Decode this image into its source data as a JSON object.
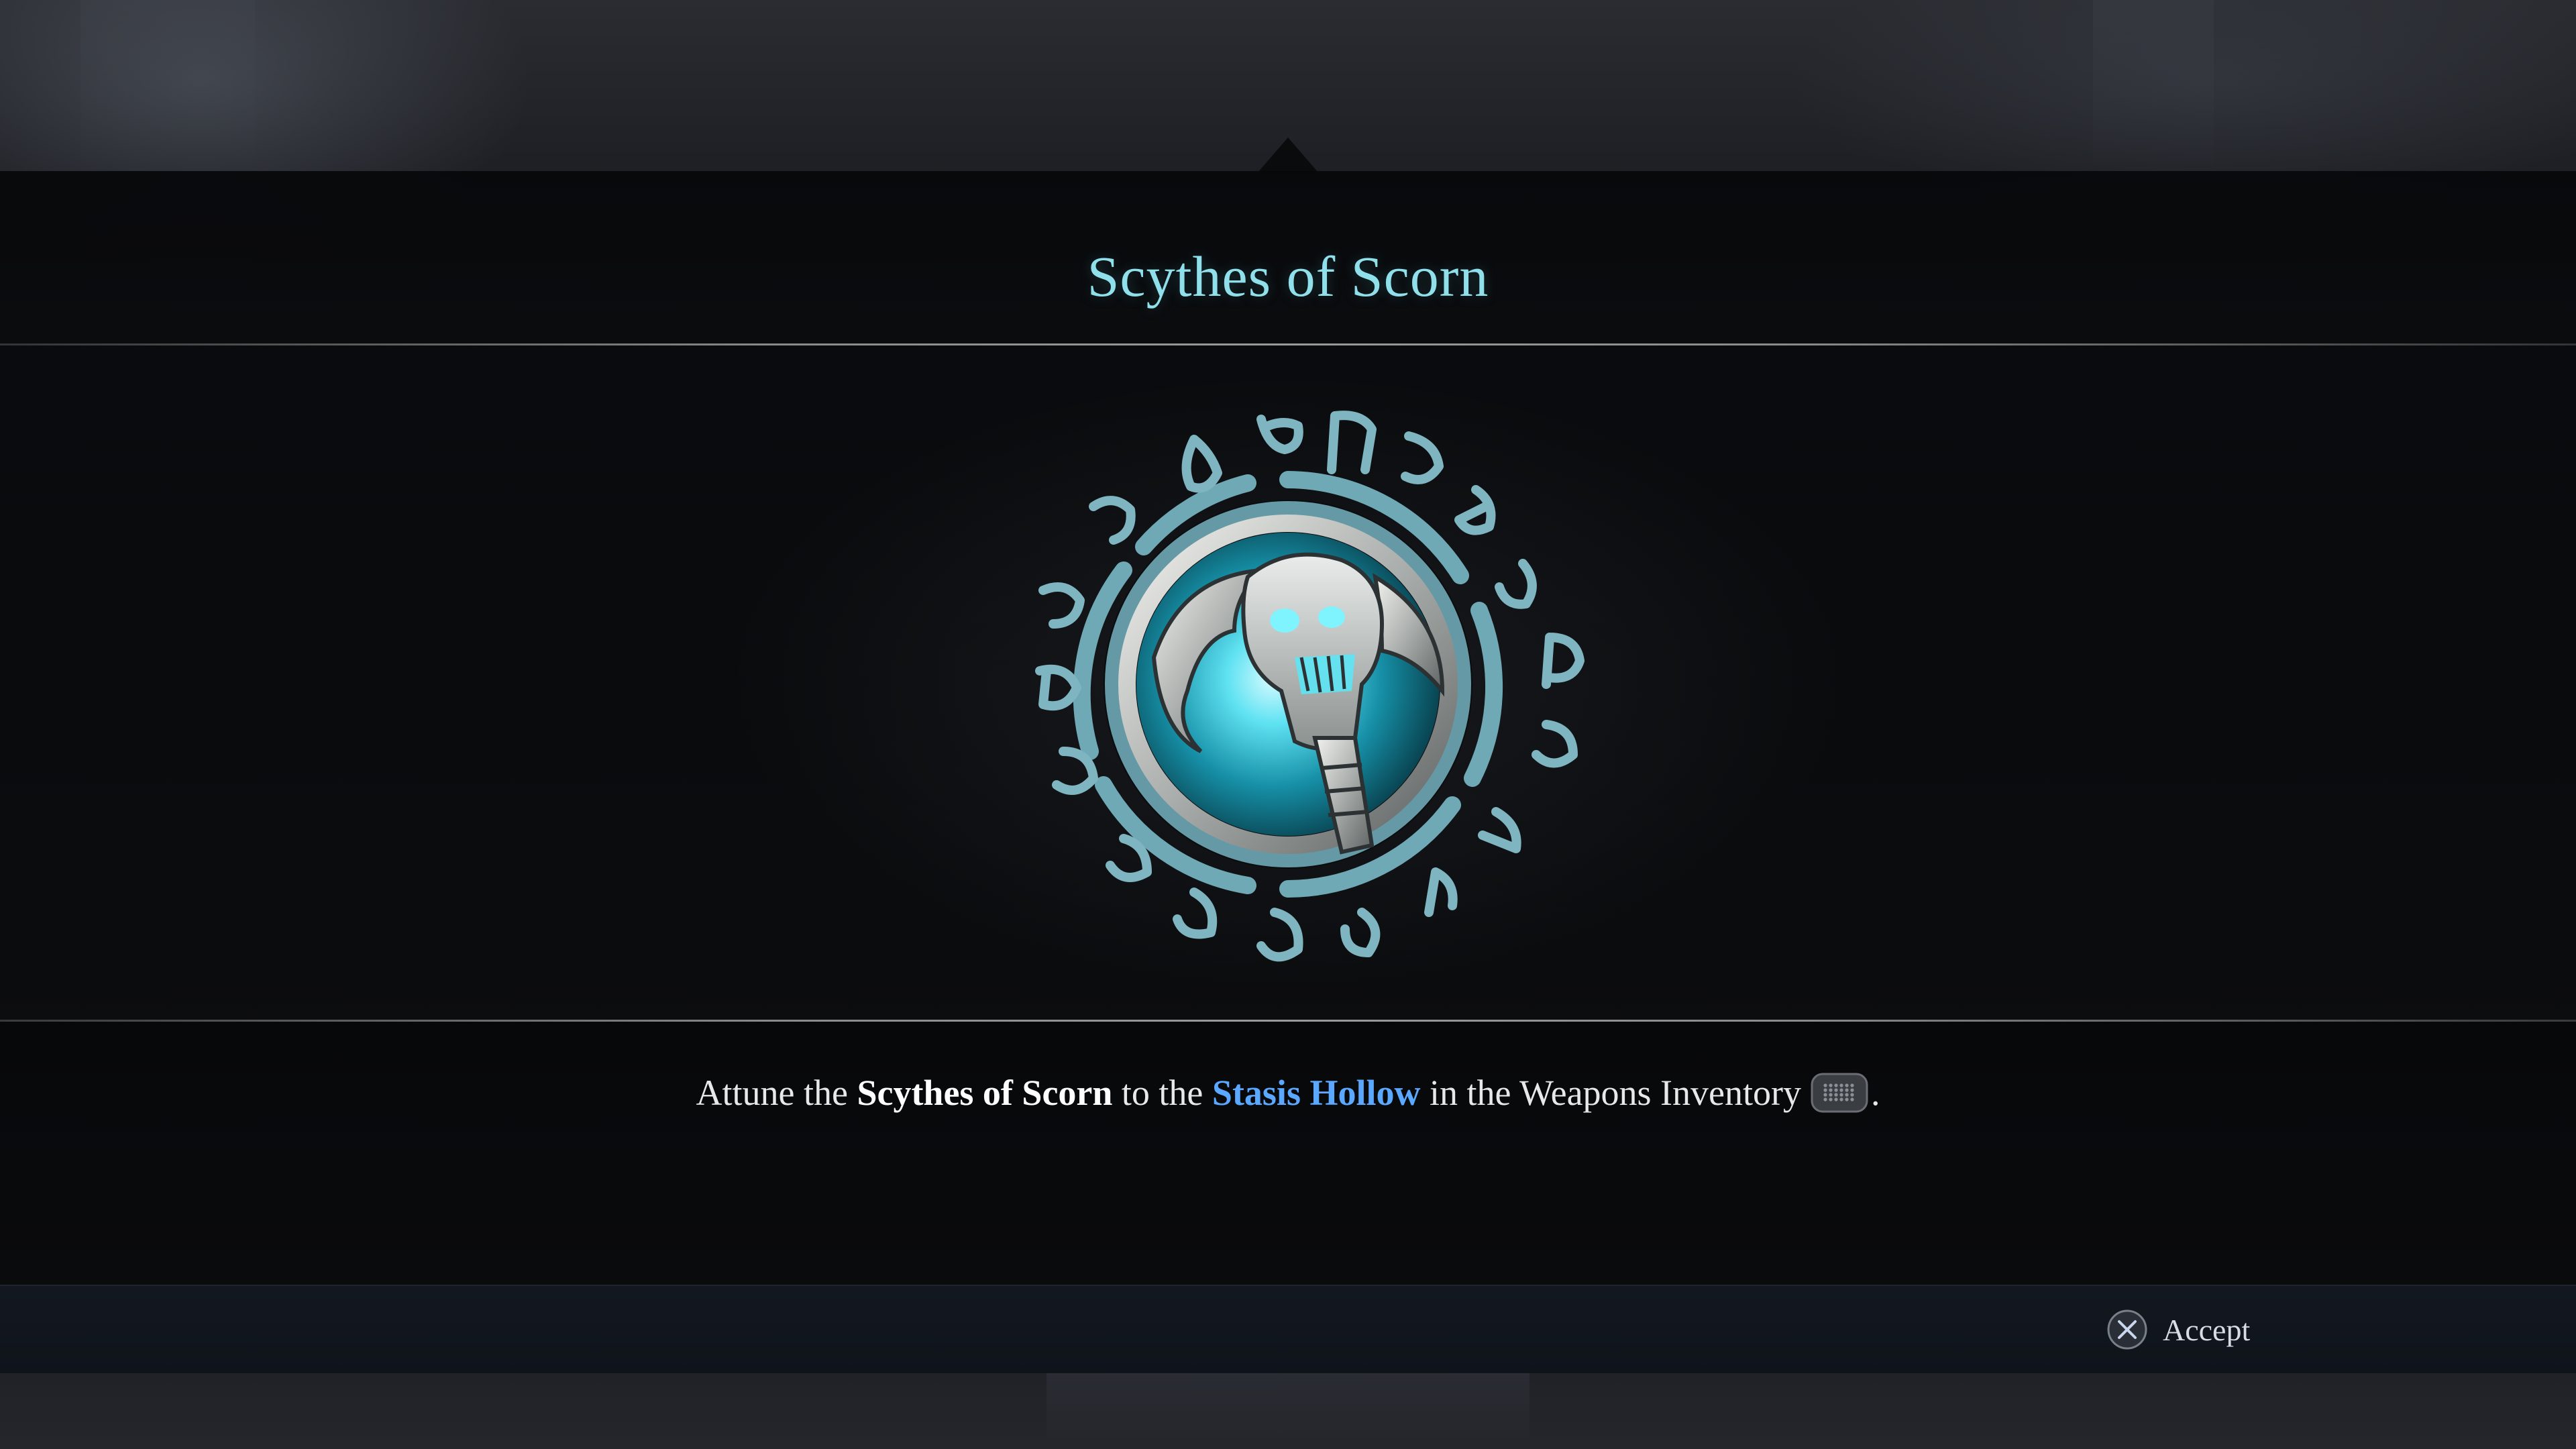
{
  "item": {
    "title": "Scythes of Scorn",
    "emblem_icon": "scythe-skull-weapon-icon"
  },
  "instruction": {
    "part1": "Attune the ",
    "weapon": "Scythes of Scorn",
    "part2": " to the ",
    "location": "Stasis Hollow",
    "part3": " in the Weapons Inventory",
    "input_icon": "touchpad-icon",
    "end": "."
  },
  "prompt": {
    "button_icon": "cross-button-icon",
    "label": "Accept"
  },
  "colors": {
    "title": "#8fe0ea",
    "highlight_location": "#5aa8ff",
    "emblem_glow": "#3fd0e6",
    "rune_ring": "#6fa9b6"
  }
}
